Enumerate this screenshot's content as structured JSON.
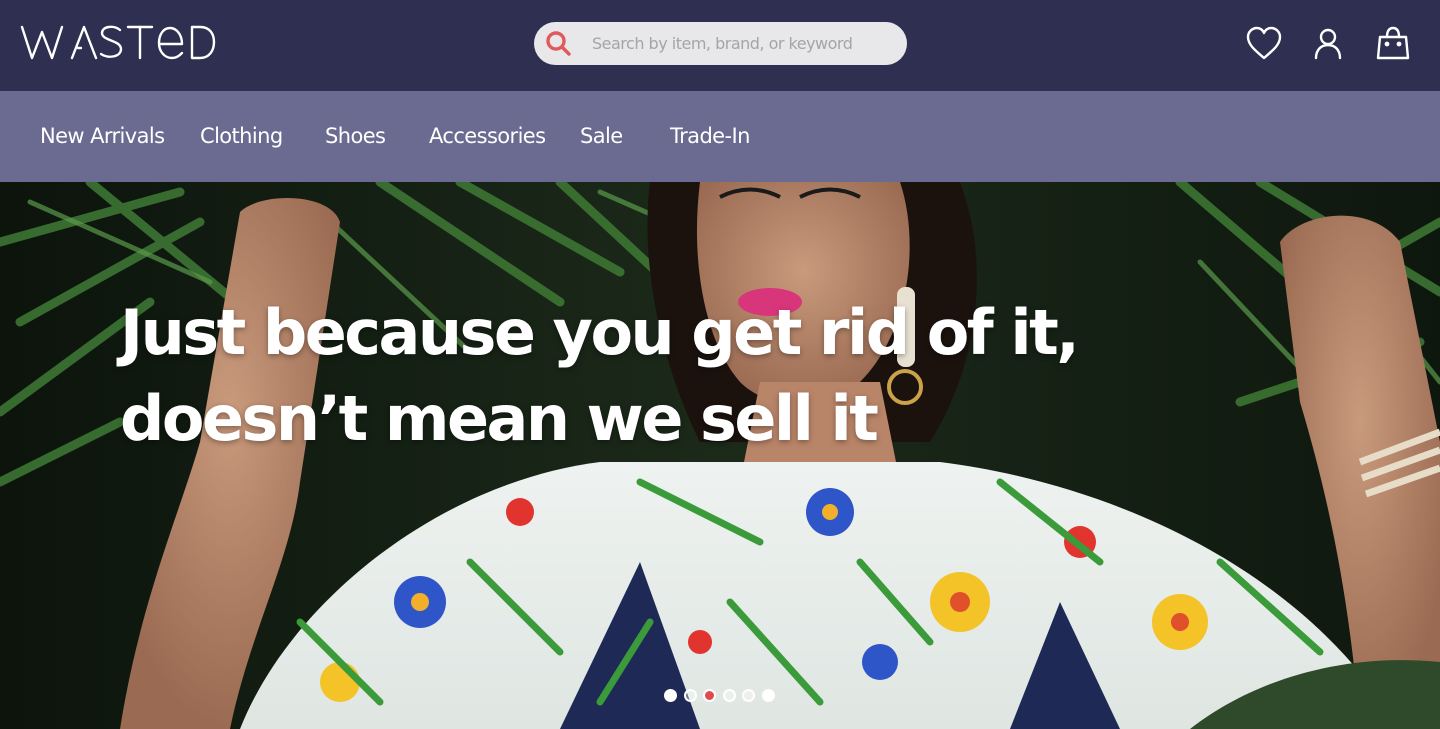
{
  "brand": {
    "logo_text": "WASTeD"
  },
  "search": {
    "placeholder": "Search by item, brand, or keyword",
    "value": ""
  },
  "header_icons": [
    "heart-icon",
    "user-icon",
    "shopping-bag-icon"
  ],
  "nav": {
    "items": [
      {
        "label": "New Arrivals"
      },
      {
        "label": "Clothing"
      },
      {
        "label": "Shoes"
      },
      {
        "label": "Accessories"
      },
      {
        "label": "Sale"
      },
      {
        "label": "Trade-In"
      }
    ]
  },
  "hero": {
    "line1": "Just because you get rid of it,",
    "line2": "doesn’t mean we sell it",
    "slide_count": 6,
    "active_slide": 1
  },
  "colors": {
    "header_bg": "#2f3051",
    "nav_bg": "#6b6a90",
    "search_icon": "#e05a5a",
    "text_light": "#ffffff"
  }
}
